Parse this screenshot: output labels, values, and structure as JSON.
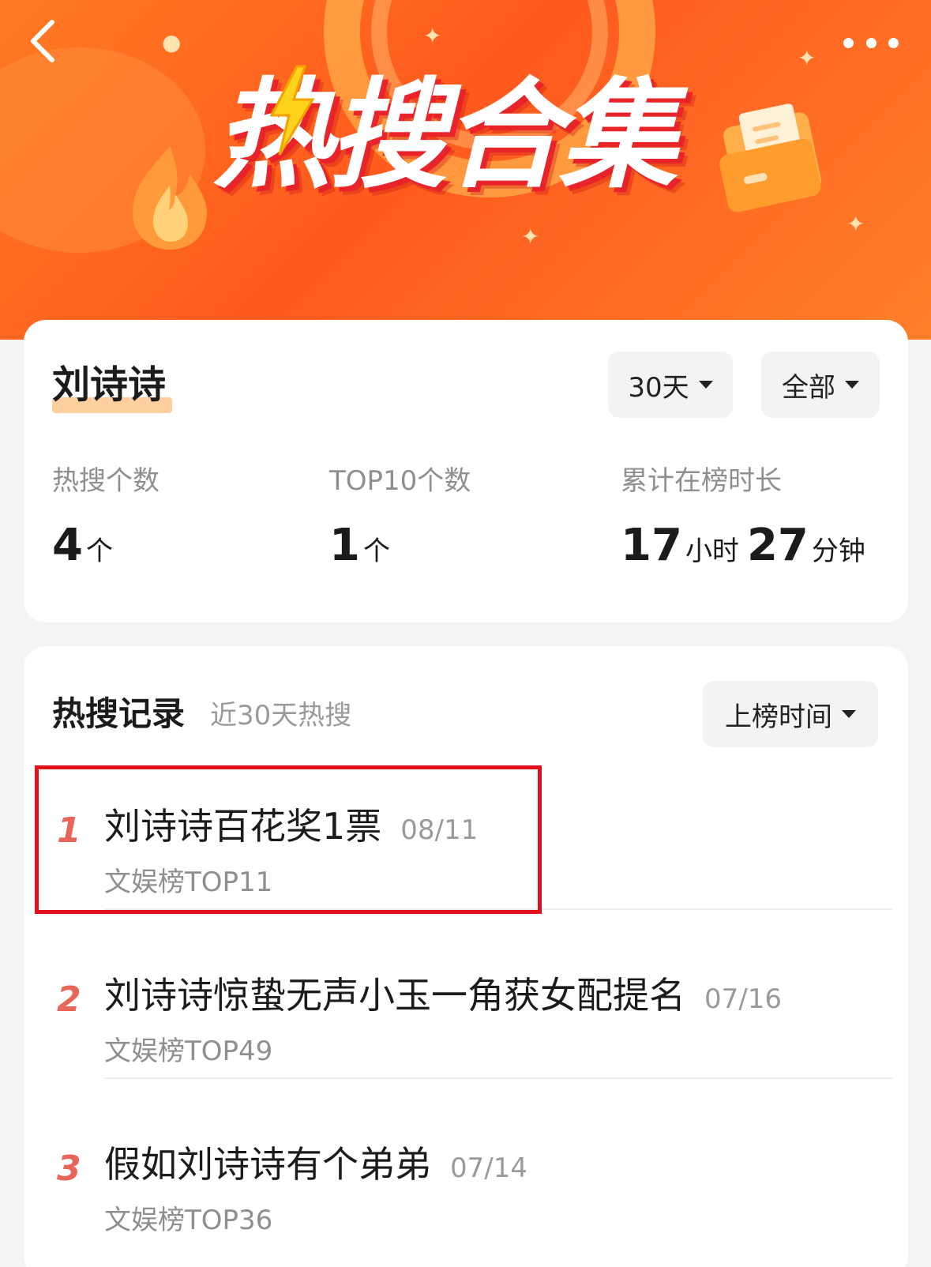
{
  "banner": {
    "title": "热搜合集",
    "colors": {
      "bg_start": "#ff7a22",
      "bg_end": "#ff5a1e",
      "title_shadow": "#e8242a"
    }
  },
  "nav": {
    "back_icon": "chevron-left-icon",
    "more_icon": "more-dots-icon"
  },
  "summary": {
    "name": "刘诗诗",
    "filters": {
      "days": "30天",
      "scope": "全部"
    },
    "stats": [
      {
        "label": "热搜个数",
        "value": "4",
        "unit": "个"
      },
      {
        "label": "TOP10个数",
        "value": "1",
        "unit": "个"
      },
      {
        "label": "累计在榜时长",
        "hours": "17",
        "hours_unit": "小时",
        "minutes": "27",
        "minutes_unit": "分钟"
      }
    ]
  },
  "records": {
    "title": "热搜记录",
    "subtitle": "近30天热搜",
    "sort": "上榜时间",
    "items": [
      {
        "rank": "1",
        "title": "刘诗诗百花奖1票",
        "date": "08/11",
        "board": "文娱榜TOP11"
      },
      {
        "rank": "2",
        "title": "刘诗诗惊蛰无声小玉一角获女配提名",
        "date": "07/16",
        "board": "文娱榜TOP49"
      },
      {
        "rank": "3",
        "title": "假如刘诗诗有个弟弟",
        "date": "07/14",
        "board": "文娱榜TOP36"
      }
    ],
    "rank_color": "#e8655a",
    "highlight_color": "#e0111b"
  }
}
